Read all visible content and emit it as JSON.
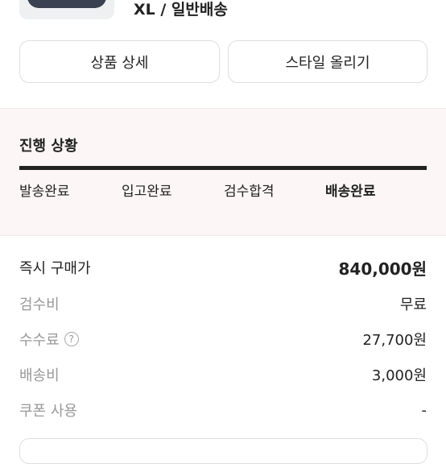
{
  "product": {
    "option_text": "XL / 일반배송"
  },
  "actions": {
    "detail_label": "상품 상세",
    "style_label": "스타일 올리기"
  },
  "progress": {
    "title": "진행 상황",
    "steps": [
      "발송완료",
      "입고완료",
      "검수합격",
      "배송완료"
    ],
    "current_step": "배송완료"
  },
  "price": {
    "rows": [
      {
        "label": "즉시 구매가",
        "value": "840,000원"
      },
      {
        "label": "검수비",
        "value": "무료"
      },
      {
        "label": "수수료",
        "value": "27,700원",
        "help_icon": "?"
      },
      {
        "label": "배송비",
        "value": "3,000원"
      },
      {
        "label": "쿠폰 사용",
        "value": "-"
      }
    ]
  }
}
